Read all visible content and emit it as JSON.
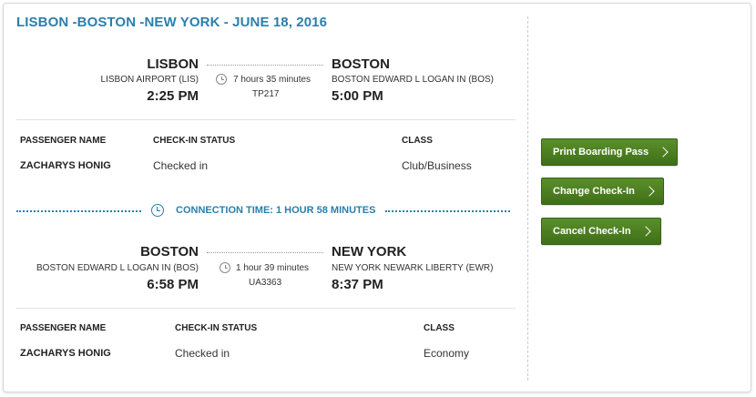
{
  "trip_title": "LISBON -BOSTON -NEW YORK - JUNE 18, 2016",
  "segments": [
    {
      "origin_city": "LISBON",
      "origin_airport": "LISBON AIRPORT (LIS)",
      "departure_time": "2:25 PM",
      "duration": "7 hours 35 minutes",
      "flight_number": "TP217",
      "destination_city": "BOSTON",
      "destination_airport": "BOSTON EDWARD L LOGAN IN (BOS)",
      "arrival_time": "5:00 PM",
      "headers": {
        "passenger": "PASSENGER NAME",
        "status": "CHECK-IN STATUS",
        "class": "CLASS"
      },
      "passenger": {
        "name": "ZACHARYS HONIG",
        "status": "Checked in",
        "class": "Club/Business"
      }
    },
    {
      "origin_city": "BOSTON",
      "origin_airport": "BOSTON EDWARD L LOGAN IN (BOS)",
      "departure_time": "6:58 PM",
      "duration": "1 hour 39 minutes",
      "flight_number": "UA3363",
      "destination_city": "NEW YORK",
      "destination_airport": "NEW YORK NEWARK LIBERTY (EWR)",
      "arrival_time": "8:37 PM",
      "headers": {
        "passenger": "PASSENGER NAME",
        "status": "CHECK-IN STATUS",
        "class": "CLASS"
      },
      "passenger": {
        "name": "ZACHARYS HONIG",
        "status": "Checked in",
        "class": "Economy"
      }
    }
  ],
  "connection": {
    "text": "CONNECTION TIME: 1 HOUR 58 MINUTES",
    "icon": "clock-icon"
  },
  "actions": {
    "print_label": "Print Boarding Pass",
    "change_label": "Change Check-In",
    "cancel_label": "Cancel Check-In"
  },
  "colors": {
    "accent": "#2a7fad",
    "button_green": "#4a7f20"
  }
}
